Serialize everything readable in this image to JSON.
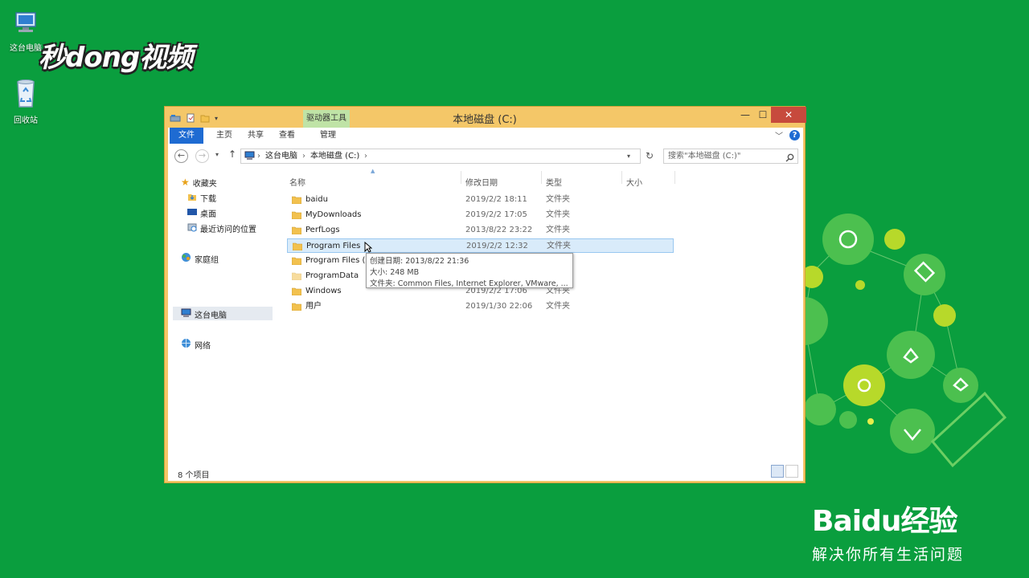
{
  "desktop": {
    "icons": [
      {
        "label": "这台电脑"
      },
      {
        "label": "回收站"
      }
    ],
    "watermark_logo": "秒dong视频",
    "baidu_brand": "Baidu经验",
    "baidu_slogan": "解决你所有生活问题"
  },
  "window": {
    "title": "本地磁盘 (C:)",
    "context_tab": "驱动器工具",
    "ribbon_tabs": [
      "文件",
      "主页",
      "共享",
      "查看",
      "管理"
    ],
    "address": {
      "segments": [
        "这台电脑",
        "本地磁盘 (C:)"
      ]
    },
    "search": {
      "placeholder": "搜索\"本地磁盘 (C:)\""
    },
    "nav": {
      "favorites": "收藏夹",
      "downloads": "下载",
      "desktop": "桌面",
      "recent": "最近访问的位置",
      "homegroup": "家庭组",
      "this_pc": "这台电脑",
      "network": "网络"
    },
    "columns": {
      "name": "名称",
      "modified": "修改日期",
      "type": "类型",
      "size": "大小"
    },
    "files": [
      {
        "name": "baidu",
        "date": "2019/2/2 18:11",
        "type": "文件夹"
      },
      {
        "name": "MyDownloads",
        "date": "2019/2/2 17:05",
        "type": "文件夹"
      },
      {
        "name": "PerfLogs",
        "date": "2013/8/22 23:22",
        "type": "文件夹"
      },
      {
        "name": "Program Files",
        "date": "2019/2/2 12:32",
        "type": "文件夹"
      },
      {
        "name": "Program Files (x",
        "date": "",
        "type": ""
      },
      {
        "name": "ProgramData",
        "date": "",
        "type": ""
      },
      {
        "name": "Windows",
        "date": "2019/2/2 17:06",
        "type": "文件夹"
      },
      {
        "name": "用户",
        "date": "2019/1/30 22:06",
        "type": "文件夹"
      }
    ],
    "tooltip": {
      "created": "创建日期: 2013/8/22 21:36",
      "size": "大小: 248 MB",
      "contents": "文件夹: Common Files, Internet Explorer, VMware, ..."
    },
    "status": "8 个项目"
  },
  "colors": {
    "desktop_bg": "#0a9e3e",
    "window_frame": "#f4c768",
    "close_button": "#c74a3d",
    "file_tab": "#1e6bd2",
    "selection": "#d9ebfa"
  }
}
